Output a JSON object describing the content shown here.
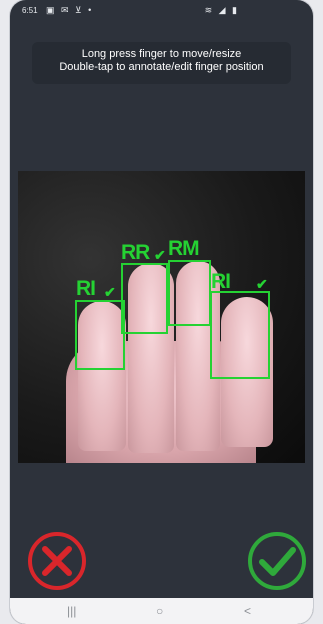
{
  "status_bar": {
    "time": "6:51",
    "notification_icons": "▣ ✉ ⊻ •",
    "system_icons": "≋ ◢ ▮"
  },
  "hint": {
    "line1": "Long press finger to move/resize",
    "line2": "Double-tap to annotate/edit finger position"
  },
  "fingers": [
    {
      "label": "RI",
      "tick": "✔"
    },
    {
      "label": "RR",
      "tick": "✔"
    },
    {
      "label": "RM",
      "tick": "✔"
    },
    {
      "label": "RI",
      "tick": "✔"
    }
  ],
  "actions": {
    "reject": "reject-x-icon",
    "accept": "accept-check-icon"
  },
  "colors": {
    "accept": "#2fa93b",
    "reject": "#d9262b",
    "detection": "#25d233"
  },
  "nav": {
    "recents": "|||",
    "home": "○",
    "back": "<"
  }
}
